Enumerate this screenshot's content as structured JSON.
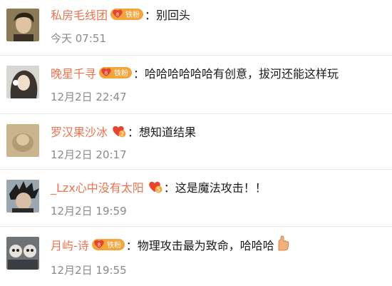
{
  "comments": [
    {
      "username": "私房毛线团",
      "badge_level": "8",
      "badge_text": "铁粉",
      "content": "：别回头",
      "time": "今天 07:51"
    },
    {
      "username": "晚星千寻",
      "badge_level": "8",
      "badge_text": "铁粉",
      "content": "：哈哈哈哈哈哈有创意，拔河还能这样玩",
      "time": "12月2日 22:47"
    },
    {
      "username": "罗汉果沙冰",
      "badge_level": "2",
      "badge_text": "",
      "content": "：想知道结果",
      "time": "12月2日 20:17"
    },
    {
      "username": "_Lzx心中没有太阳",
      "badge_level": "5",
      "badge_text": "",
      "content": "：这是魔法攻击！！",
      "time": "12月2日 19:59"
    },
    {
      "username": "月屿-诗",
      "badge_level": "8",
      "badge_text": "铁粉",
      "content": "：物理攻击最为致命，哈哈哈",
      "time": "12月2日 19:55"
    }
  ],
  "colors": {
    "username": "#eb7350",
    "text": "#1a1a1a",
    "time": "#8a8a8a",
    "badge": "#f3a53c",
    "badge_heart": "#e8432e"
  },
  "icons": [
    "avatar-image",
    "fan-badge-icon",
    "facepalm-emoji-icon"
  ]
}
